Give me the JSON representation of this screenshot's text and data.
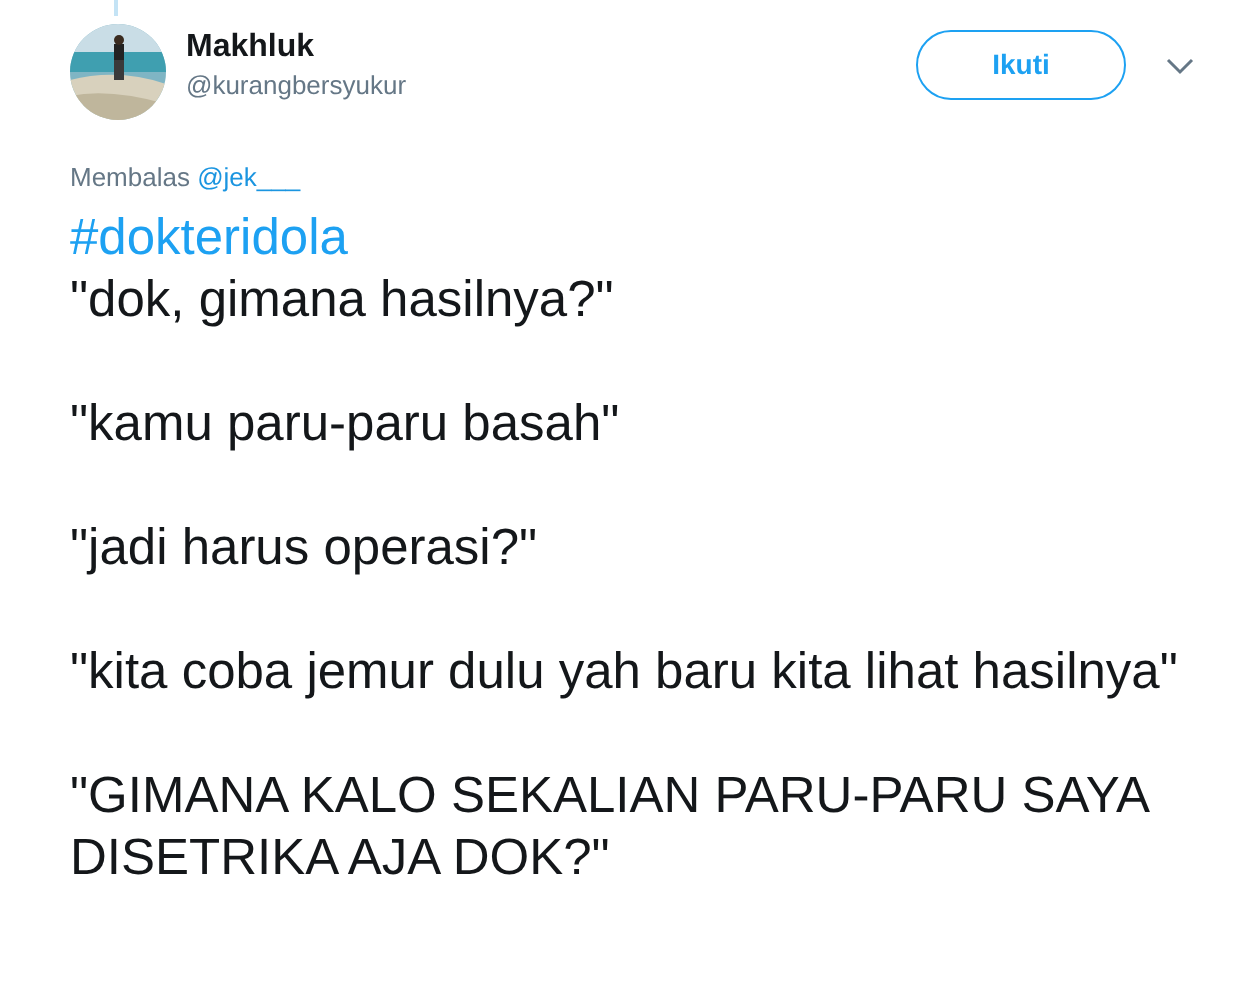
{
  "author": {
    "name": "Makhluk",
    "handle": "@kurangbersyukur"
  },
  "follow_button": {
    "label": "Ikuti"
  },
  "reply_context": {
    "prefix": "Membalas",
    "mention": "@jek___"
  },
  "hashtag": "#dokteridola",
  "paragraphs": [
    "\"dok, gimana hasilnya?\"",
    "\"kamu paru-paru basah\"",
    "\"jadi harus operasi?\"",
    "\"kita coba jemur dulu yah baru kita lihat hasilnya\"",
    "\"GIMANA KALO SEKALIAN PARU-PARU SAYA DISETRIKA AJA DOK?\""
  ]
}
